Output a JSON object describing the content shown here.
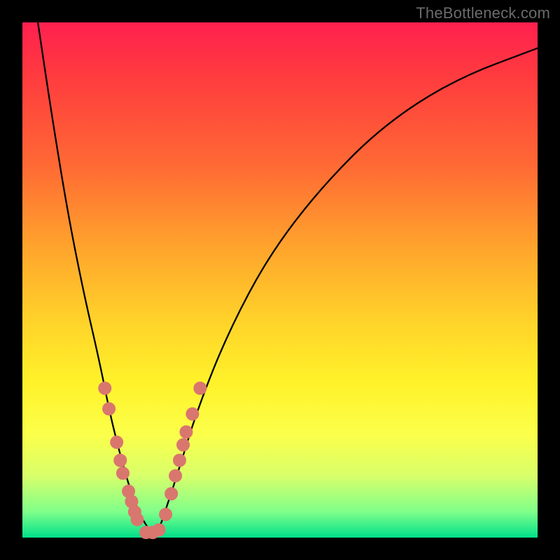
{
  "watermark": "TheBottleneck.com",
  "colors": {
    "frame": "#000000",
    "grad_top": "#ff2050",
    "grad_bottom": "#00e08a",
    "curve": "#000000",
    "dot": "#d9766e"
  },
  "chart_data": {
    "type": "line",
    "title": "",
    "xlabel": "",
    "ylabel": "",
    "xlim": [
      0,
      100
    ],
    "ylim": [
      0,
      100
    ],
    "comment": "Two sharp curve branches descending to a narrow minimum near x≈25. Values read as approximate y-height in percent of plot height (0=bottom, 100=top).",
    "series": [
      {
        "name": "left-branch",
        "x": [
          3,
          6,
          9,
          12,
          15,
          17,
          19,
          21,
          23,
          25
        ],
        "values": [
          100,
          80,
          62,
          47,
          34,
          24,
          16,
          9,
          4,
          1
        ]
      },
      {
        "name": "right-branch",
        "x": [
          27,
          30,
          34,
          40,
          48,
          58,
          70,
          84,
          100
        ],
        "values": [
          3,
          12,
          25,
          40,
          55,
          68,
          80,
          89,
          95
        ]
      }
    ],
    "sample_points": {
      "name": "markers",
      "comment": "pink dots overlaid near lower parts of both branches",
      "x": [
        16.0,
        16.8,
        18.3,
        19.0,
        19.5,
        20.6,
        21.2,
        21.8,
        22.3,
        24.0,
        25.3,
        26.5,
        27.8,
        28.9,
        29.7,
        30.5,
        31.2,
        31.8,
        33.0,
        34.5
      ],
      "values": [
        29.0,
        25.0,
        18.5,
        15.0,
        12.5,
        9.0,
        7.0,
        5.0,
        3.5,
        1.0,
        1.0,
        1.5,
        4.5,
        8.5,
        12.0,
        15.0,
        18.0,
        20.5,
        24.0,
        29.0
      ]
    }
  }
}
